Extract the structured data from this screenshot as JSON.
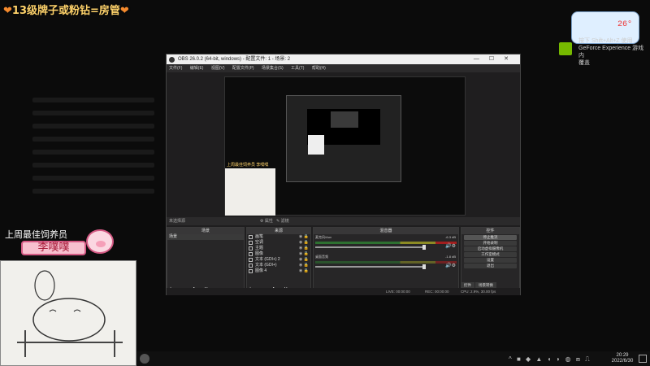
{
  "overlay": {
    "top_banner": "13级牌子或粉钻=房管",
    "left_title": "上周最佳饲养员",
    "left_name": "李噗噗",
    "widget_value": "26°",
    "nvidia_line1": "按下 Shift+Alt+Z 使用",
    "nvidia_line2": "GeForce Experience 游戏内",
    "nvidia_line3": "覆盖"
  },
  "obs": {
    "title": "OBS 26.0.2 (64-bit, windows) - 配置文件: 1 - 场景: 2",
    "window_controls": [
      "—",
      "☐",
      "✕"
    ],
    "menu": [
      "文件(F)",
      "编辑(E)",
      "视图(V)",
      "配置文件(P)",
      "场景集合(S)",
      "工具(T)",
      "帮助(H)"
    ],
    "preview_tag": "上周最佳饲养员 李噗噗",
    "toolbar_label": "未选择源",
    "toolbar_props": "⚙ 属性",
    "toolbar_filters": "✎ 滤镜",
    "docks": {
      "scenes": "场景",
      "sources": "来源",
      "mixer": "混音器",
      "controls": "控件"
    },
    "scenes": [
      "场景"
    ],
    "sources": [
      "画笔",
      "空调",
      "主题",
      "图像",
      "文本 (GDI+) 2",
      "文本 (GDI+)",
      "图像 4"
    ],
    "mixer": [
      {
        "label": "麦克风/Aux",
        "db": "-6.3 dB"
      },
      {
        "label": "桌面音频",
        "db": "-1.8 dB"
      }
    ],
    "controls": [
      "停止推流",
      "开始录制",
      "启动虚拟摄像机",
      "工作室模式",
      "设置",
      "退出"
    ],
    "control_tabs": [
      "控件",
      "场景转换"
    ],
    "footer_icons": "+ − ∧ ∨",
    "status_live": "LIVE: 00:00:00",
    "status_rec": "REC: 00:00:00",
    "status_cpu": "CPU: 2.9%, 30.00 fps"
  },
  "taskbar": {
    "tray": "^ ■ ◆ ▲ ◖ ◗ ◍ ⧈ ⎍",
    "time": "20:29",
    "date": "2022/6/30"
  },
  "colors": {
    "banner": "#ffd36b",
    "obs_bg": "#1f1e1f",
    "dock_title": "#383738",
    "meter_green": "#2e7d32",
    "accent_pink": "#d45a84"
  }
}
